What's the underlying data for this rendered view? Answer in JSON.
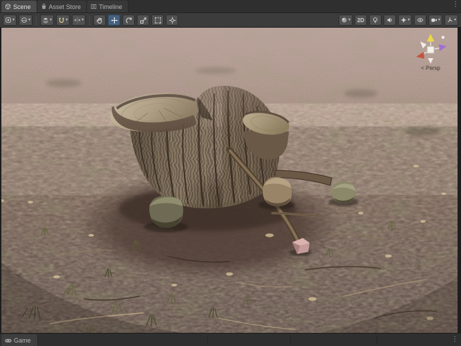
{
  "tabs": {
    "items": [
      {
        "label": "Scene",
        "active": true,
        "icon": "scene-cube-icon"
      },
      {
        "label": "Asset Store",
        "active": false,
        "icon": "asset-store-bag-icon"
      },
      {
        "label": "Timeline",
        "active": false,
        "icon": "timeline-icon"
      }
    ],
    "overflow_icon": "kebab-menu",
    "overflow_glyph": "⋮"
  },
  "toolbar": {
    "left_dropdowns": [
      {
        "icon": "render-mode-icon"
      },
      {
        "icon": "shaded-sphere-icon"
      },
      {
        "icon": "layers-icon"
      },
      {
        "icon": "snap-magnet-icon"
      },
      {
        "icon": "mirror-axis-icon"
      }
    ],
    "tools": [
      {
        "name": "view-hand-tool",
        "icon": "hand-tool-icon",
        "active": false
      },
      {
        "name": "move-tool",
        "icon": "move-tool-icon",
        "active": true
      },
      {
        "name": "rotate-tool",
        "icon": "rotate-tool-icon",
        "active": false
      },
      {
        "name": "scale-tool",
        "icon": "scale-tool-icon",
        "active": false
      },
      {
        "name": "rect-tool",
        "icon": "rect-tool-icon",
        "active": false
      },
      {
        "name": "transform-tool",
        "icon": "transform-tool-icon",
        "active": false
      }
    ],
    "right_controls": [
      {
        "name": "shading-mode-dropdown",
        "icon": "shaded-sphere-icon",
        "dropdown": true
      },
      {
        "name": "2d-toggle",
        "label": "2D"
      },
      {
        "name": "lighting-toggle",
        "icon": "lighting-bulb-icon"
      },
      {
        "name": "audio-toggle",
        "icon": "audio-speaker-icon"
      },
      {
        "name": "effects-dropdown",
        "icon": "effects-star-icon",
        "dropdown": true
      },
      {
        "name": "visibility-toggle",
        "icon": "visibility-eye-icon"
      },
      {
        "name": "camera-dropdown",
        "icon": "camera-icon",
        "dropdown": true
      },
      {
        "name": "gizmos-dropdown",
        "icon": "gizmos-icon",
        "dropdown": true
      }
    ],
    "caret_glyph": "▾"
  },
  "viewport": {
    "projection_label": "< Persp",
    "gizmo_axis_colors": {
      "up": "#e8d84a",
      "left": "#c3543e",
      "right": "#a06fd2",
      "neutral": "#efece4"
    },
    "scene_objects": [
      "large cut tree stump with bark fissures",
      "dirt and leaf-litter mound",
      "mossy rock",
      "tan rock",
      "gray-green rock",
      "leaning fallen branch",
      "horizontal log",
      "small pink cube rock",
      "grass tufts and twigs",
      "hazy forest-floor terrain to horizon"
    ]
  },
  "bottom": {
    "tabs": [
      {
        "label": "Game",
        "icon": "gamepad-icon"
      }
    ],
    "overflow_icon": "kebab-menu",
    "overflow_glyph": "⋮"
  },
  "colors": {
    "tabbar_bg": "#2f2f2f",
    "active_tab_bg": "#4c4c4c",
    "toolbar_bg": "#3c3c3c",
    "button_bg": "#515151",
    "active_tool_bg": "#46617f",
    "fog_far": "#a8908a",
    "ground_mid": "#7a6257",
    "ground_near": "#53423e",
    "bark": "#7b6c5b",
    "cut_wood": "#bcae92",
    "pink_rock": "#d0a3a0"
  }
}
